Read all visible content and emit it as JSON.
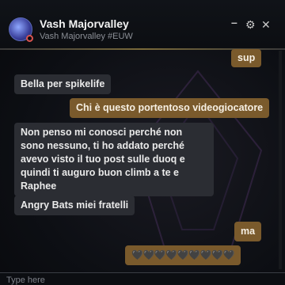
{
  "header": {
    "name": "Vash Majorvalley",
    "tag": "Vash Majorvalley #EUW",
    "icons": {
      "minimize": "minimize-icon",
      "settings": "gear-icon",
      "close": "close-icon"
    }
  },
  "messages": [
    {
      "from": "them",
      "text": "sup"
    },
    {
      "from": "other",
      "text": "Bella per spikelife"
    },
    {
      "from": "them",
      "text": "Chi è questo portentoso videogiocatore"
    },
    {
      "from": "other",
      "text": "Non penso mi conosci perché non sono nessuno, ti ho addato perché avevo visto il tuo post sulle duoq e quindi ti auguro buon climb a te e Raphee"
    },
    {
      "from": "other",
      "text": "Angry Bats miei fratelli"
    },
    {
      "from": "them",
      "text": "ma"
    },
    {
      "from": "them",
      "text": "🖤🖤🖤🖤🖤🖤🖤🖤🖤"
    }
  ],
  "input": {
    "placeholder": "Type here"
  },
  "colors": {
    "sent": "#7a5a2c",
    "received": "#2b2d33",
    "status": "#d9534f"
  }
}
